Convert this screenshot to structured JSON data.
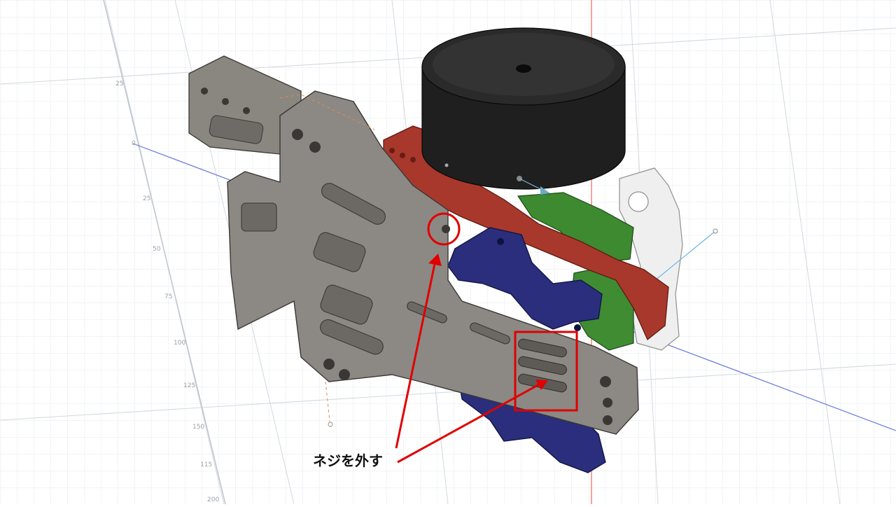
{
  "viewport": {
    "background": "#ffffff",
    "grid_color": "#d9dde3",
    "axis_blue": "#5b6ee1",
    "axis_red": "#e0463a"
  },
  "ruler": {
    "ticks": [
      "25",
      "0",
      "25",
      "50",
      "75",
      "100",
      "125",
      "150",
      "115",
      "200"
    ]
  },
  "parts": {
    "motor_color": "#1c1c1c",
    "plate_color": "#8a8782",
    "red_bracket_color": "#b03a2e",
    "blue_mount_color": "#2b2f7a",
    "green_part_color": "#3f8a32",
    "white_part_color": "#eeeeee"
  },
  "annotation": {
    "label": "ネジを外す",
    "color": "#e10000"
  }
}
